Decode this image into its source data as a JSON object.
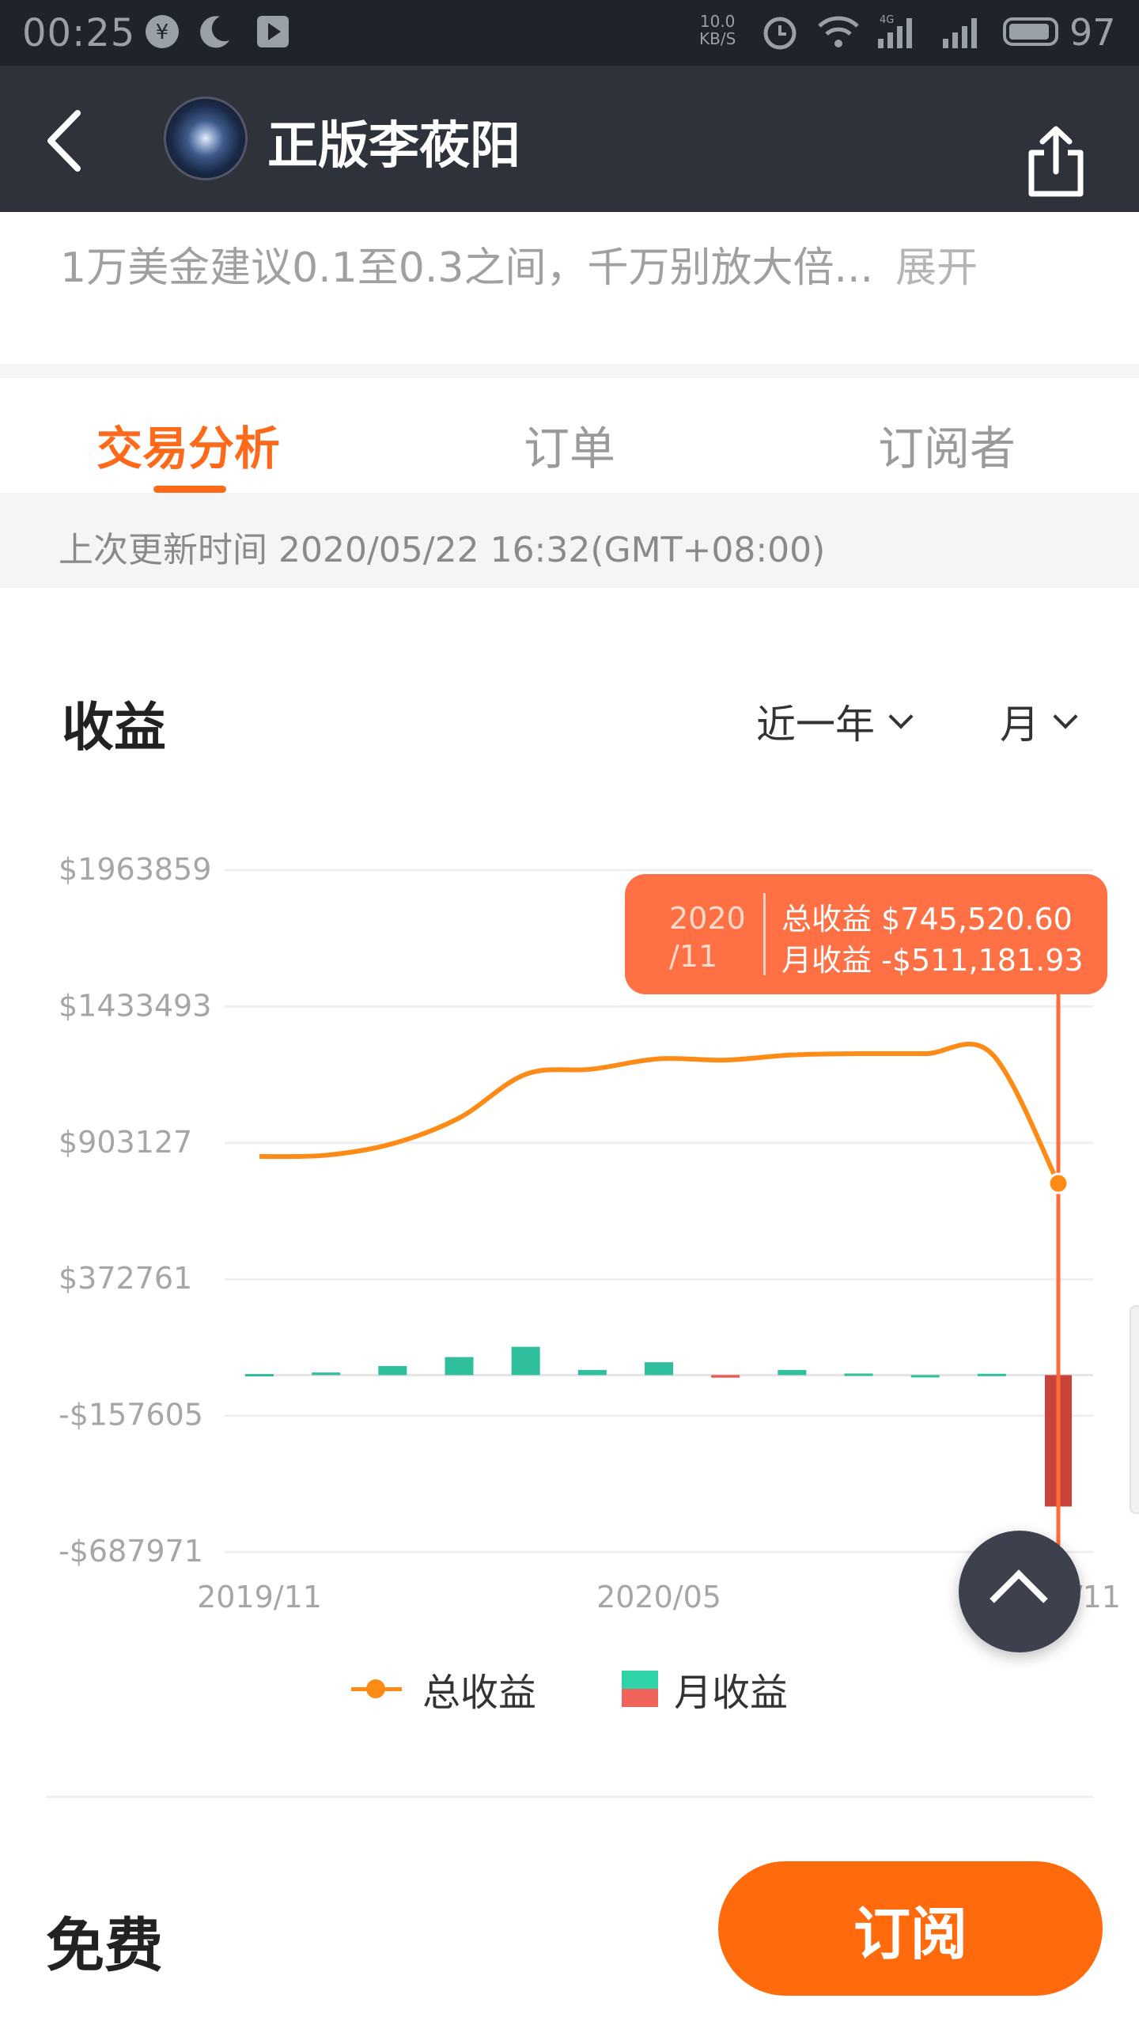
{
  "status_bar": {
    "time": "00:25",
    "speed_value": "10.0",
    "speed_unit": "KB/S",
    "network_label": "4G",
    "battery": "97"
  },
  "nav": {
    "title": "正版李莜阳",
    "back_icon": "back-arrow-icon",
    "share_icon": "share-icon"
  },
  "description": {
    "text": "1万美金建议0.1至0.3之间，千万别放大倍...",
    "expand_label": "展开"
  },
  "tabs": [
    {
      "label": "交易分析",
      "active": true
    },
    {
      "label": "订单",
      "active": false
    },
    {
      "label": "订阅者",
      "active": false
    }
  ],
  "update": {
    "text": "上次更新时间 2020/05/22 16:32(GMT+08:00)"
  },
  "section": {
    "title": "收益",
    "range_label": "近一年",
    "period_label": "月"
  },
  "chart_data": {
    "type": "line",
    "yticks": [
      "$1963859",
      "$1433493",
      "$903127",
      "$372761",
      "-$157605",
      "-$687971"
    ],
    "ytick_values": [
      1963859,
      1433493,
      903127,
      372761,
      -157605,
      -687971
    ],
    "xticks": [
      "2019/11",
      "2020/05",
      "2020/11"
    ],
    "categories": [
      "2019/11",
      "2019/12",
      "2020/01",
      "2020/02",
      "2020/03",
      "2020/04",
      "2020/05",
      "2020/06",
      "2020/07",
      "2020/08",
      "2020/09",
      "2020/10",
      "2020/11"
    ],
    "series": [
      {
        "name": "总收益",
        "color": "#ff8b17",
        "values": [
          850000,
          855000,
          900000,
          1000000,
          1170000,
          1190000,
          1230000,
          1225000,
          1245000,
          1250000,
          1250000,
          1250000,
          745520.6
        ]
      },
      {
        "name": "月收益",
        "type": "bar",
        "positive_color": "#2fbf9c",
        "negative_color": "#e55a4c",
        "values": [
          4000,
          10000,
          35000,
          70000,
          110000,
          20000,
          50000,
          -10000,
          20000,
          6000,
          0,
          5000,
          -511181.93
        ]
      }
    ],
    "ylim": [
      -687971,
      1963859
    ],
    "grid": true,
    "legend": [
      "总收益",
      "月收益"
    ]
  },
  "tooltip": {
    "date": "2020/11",
    "date_line1": "2020",
    "date_line2": "/11",
    "total_label": "总收益",
    "total_value": "$745,520.60",
    "monthly_label": "月收益",
    "monthly_value": "-$511,181.93"
  },
  "legend": {
    "total_label": "总收益",
    "monthly_label": "月收益"
  },
  "bottom": {
    "price_label": "免费",
    "subscribe_label": "订阅"
  }
}
